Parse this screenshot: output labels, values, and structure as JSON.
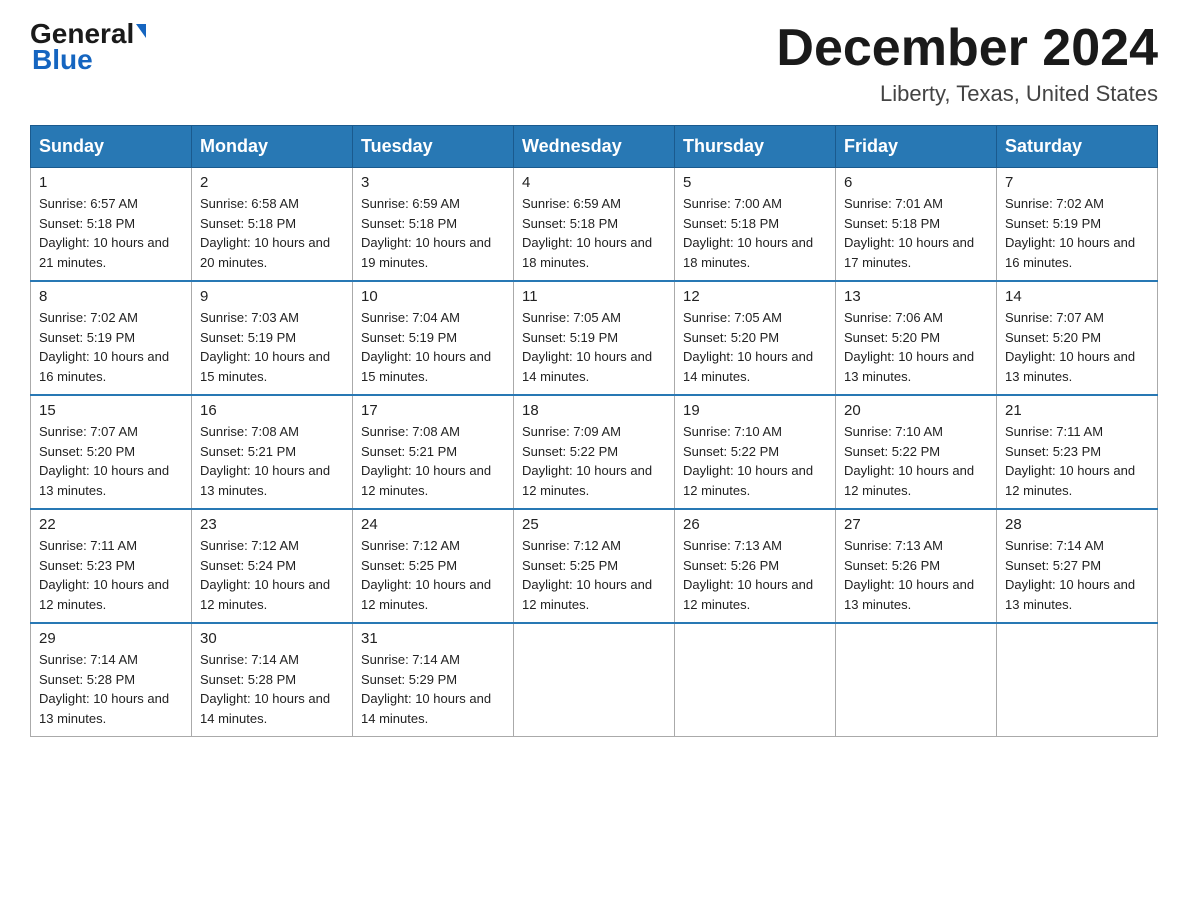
{
  "logo": {
    "line1": "General",
    "arrow": "▶",
    "line2": "Blue"
  },
  "header": {
    "month": "December 2024",
    "location": "Liberty, Texas, United States"
  },
  "weekdays": [
    "Sunday",
    "Monday",
    "Tuesday",
    "Wednesday",
    "Thursday",
    "Friday",
    "Saturday"
  ],
  "weeks": [
    [
      {
        "day": "1",
        "sunrise": "6:57 AM",
        "sunset": "5:18 PM",
        "daylight": "10 hours and 21 minutes."
      },
      {
        "day": "2",
        "sunrise": "6:58 AM",
        "sunset": "5:18 PM",
        "daylight": "10 hours and 20 minutes."
      },
      {
        "day": "3",
        "sunrise": "6:59 AM",
        "sunset": "5:18 PM",
        "daylight": "10 hours and 19 minutes."
      },
      {
        "day": "4",
        "sunrise": "6:59 AM",
        "sunset": "5:18 PM",
        "daylight": "10 hours and 18 minutes."
      },
      {
        "day": "5",
        "sunrise": "7:00 AM",
        "sunset": "5:18 PM",
        "daylight": "10 hours and 18 minutes."
      },
      {
        "day": "6",
        "sunrise": "7:01 AM",
        "sunset": "5:18 PM",
        "daylight": "10 hours and 17 minutes."
      },
      {
        "day": "7",
        "sunrise": "7:02 AM",
        "sunset": "5:19 PM",
        "daylight": "10 hours and 16 minutes."
      }
    ],
    [
      {
        "day": "8",
        "sunrise": "7:02 AM",
        "sunset": "5:19 PM",
        "daylight": "10 hours and 16 minutes."
      },
      {
        "day": "9",
        "sunrise": "7:03 AM",
        "sunset": "5:19 PM",
        "daylight": "10 hours and 15 minutes."
      },
      {
        "day": "10",
        "sunrise": "7:04 AM",
        "sunset": "5:19 PM",
        "daylight": "10 hours and 15 minutes."
      },
      {
        "day": "11",
        "sunrise": "7:05 AM",
        "sunset": "5:19 PM",
        "daylight": "10 hours and 14 minutes."
      },
      {
        "day": "12",
        "sunrise": "7:05 AM",
        "sunset": "5:20 PM",
        "daylight": "10 hours and 14 minutes."
      },
      {
        "day": "13",
        "sunrise": "7:06 AM",
        "sunset": "5:20 PM",
        "daylight": "10 hours and 13 minutes."
      },
      {
        "day": "14",
        "sunrise": "7:07 AM",
        "sunset": "5:20 PM",
        "daylight": "10 hours and 13 minutes."
      }
    ],
    [
      {
        "day": "15",
        "sunrise": "7:07 AM",
        "sunset": "5:20 PM",
        "daylight": "10 hours and 13 minutes."
      },
      {
        "day": "16",
        "sunrise": "7:08 AM",
        "sunset": "5:21 PM",
        "daylight": "10 hours and 13 minutes."
      },
      {
        "day": "17",
        "sunrise": "7:08 AM",
        "sunset": "5:21 PM",
        "daylight": "10 hours and 12 minutes."
      },
      {
        "day": "18",
        "sunrise": "7:09 AM",
        "sunset": "5:22 PM",
        "daylight": "10 hours and 12 minutes."
      },
      {
        "day": "19",
        "sunrise": "7:10 AM",
        "sunset": "5:22 PM",
        "daylight": "10 hours and 12 minutes."
      },
      {
        "day": "20",
        "sunrise": "7:10 AM",
        "sunset": "5:22 PM",
        "daylight": "10 hours and 12 minutes."
      },
      {
        "day": "21",
        "sunrise": "7:11 AM",
        "sunset": "5:23 PM",
        "daylight": "10 hours and 12 minutes."
      }
    ],
    [
      {
        "day": "22",
        "sunrise": "7:11 AM",
        "sunset": "5:23 PM",
        "daylight": "10 hours and 12 minutes."
      },
      {
        "day": "23",
        "sunrise": "7:12 AM",
        "sunset": "5:24 PM",
        "daylight": "10 hours and 12 minutes."
      },
      {
        "day": "24",
        "sunrise": "7:12 AM",
        "sunset": "5:25 PM",
        "daylight": "10 hours and 12 minutes."
      },
      {
        "day": "25",
        "sunrise": "7:12 AM",
        "sunset": "5:25 PM",
        "daylight": "10 hours and 12 minutes."
      },
      {
        "day": "26",
        "sunrise": "7:13 AM",
        "sunset": "5:26 PM",
        "daylight": "10 hours and 12 minutes."
      },
      {
        "day": "27",
        "sunrise": "7:13 AM",
        "sunset": "5:26 PM",
        "daylight": "10 hours and 13 minutes."
      },
      {
        "day": "28",
        "sunrise": "7:14 AM",
        "sunset": "5:27 PM",
        "daylight": "10 hours and 13 minutes."
      }
    ],
    [
      {
        "day": "29",
        "sunrise": "7:14 AM",
        "sunset": "5:28 PM",
        "daylight": "10 hours and 13 minutes."
      },
      {
        "day": "30",
        "sunrise": "7:14 AM",
        "sunset": "5:28 PM",
        "daylight": "10 hours and 14 minutes."
      },
      {
        "day": "31",
        "sunrise": "7:14 AM",
        "sunset": "5:29 PM",
        "daylight": "10 hours and 14 minutes."
      },
      null,
      null,
      null,
      null
    ]
  ]
}
